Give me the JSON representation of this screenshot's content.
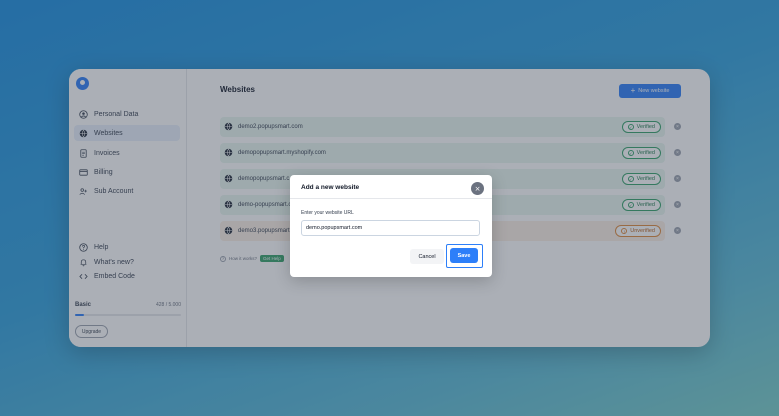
{
  "sidebar": {
    "items": [
      {
        "label": "Personal Data",
        "icon": "user-circle-icon"
      },
      {
        "label": "Websites",
        "icon": "globe-icon",
        "active": true
      },
      {
        "label": "Invoices",
        "icon": "document-icon"
      },
      {
        "label": "Billing",
        "icon": "card-icon"
      },
      {
        "label": "Sub Account",
        "icon": "users-icon"
      }
    ],
    "bottom_items": [
      {
        "label": "Help",
        "icon": "help-circle-icon"
      },
      {
        "label": "What's new?",
        "icon": "bell-icon"
      },
      {
        "label": "Embed Code",
        "icon": "code-icon"
      }
    ],
    "plan": {
      "name": "Basic",
      "usage": "428 / 5.000",
      "progress": 0.0856
    },
    "upgrade_label": "Upgrade"
  },
  "main": {
    "title": "Websites",
    "new_button_label": "New website",
    "sites": [
      {
        "domain": "demo2.popupsmart.com",
        "status": "Verified"
      },
      {
        "domain": "demopopupsmart.myshopify.com",
        "status": "Verified"
      },
      {
        "domain": "demopopupsmart.c",
        "status": "Verified"
      },
      {
        "domain": "demo-popupsmart.c",
        "status": "Verified"
      },
      {
        "domain": "demo3.popupsmart.c",
        "status": "Unverified"
      }
    ],
    "how_to_text": "How it works?",
    "how_to_link": "Get Help"
  },
  "modal": {
    "title": "Add a new website",
    "url_label": "Enter your website URL",
    "url_value": "demo.popupsmart.com",
    "cancel_label": "Cancel",
    "save_label": "Save"
  },
  "colors": {
    "accent": "#2d7ff9",
    "verified": "#34a26a",
    "unverified": "#e08a3c"
  }
}
